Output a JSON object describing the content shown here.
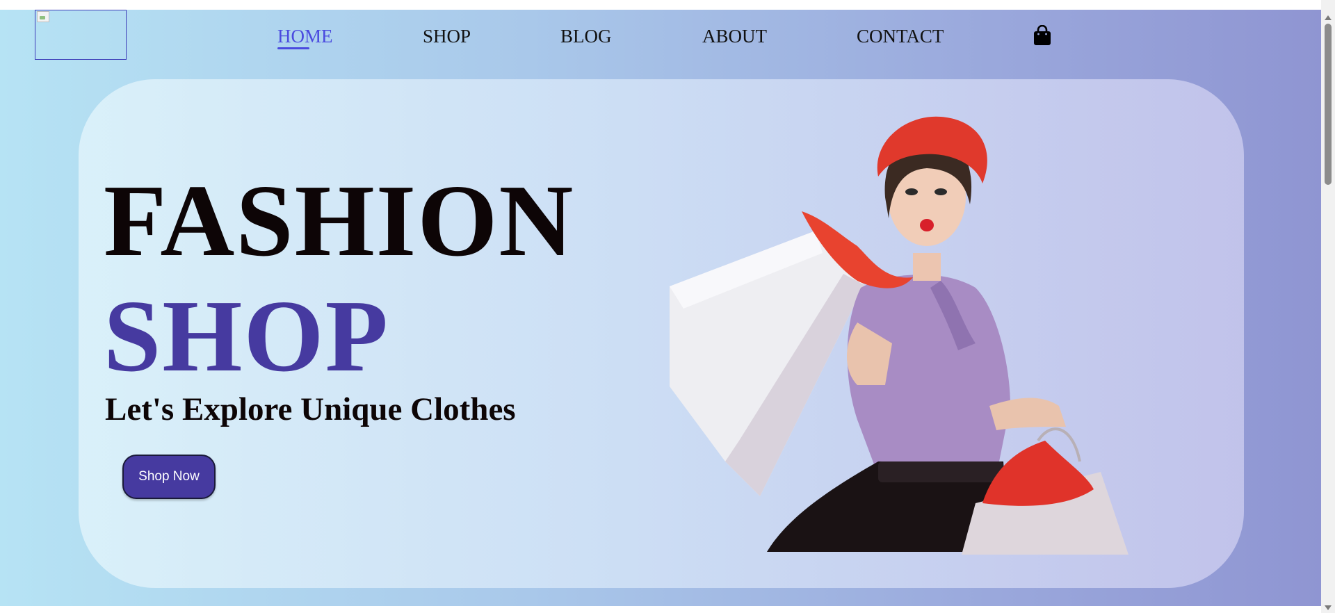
{
  "header": {
    "logo_alt": "",
    "nav": [
      {
        "label": "HOME",
        "active": true
      },
      {
        "label": "SHOP"
      },
      {
        "label": "BLOG"
      },
      {
        "label": "ABOUT"
      },
      {
        "label": "CONTACT"
      }
    ],
    "cart_icon": "shopping-bag-icon"
  },
  "hero": {
    "title_line1": "FASHION",
    "title_line2": "SHOP",
    "subtitle": "Let's Explore Unique Clothes",
    "cta_label": "Shop Now",
    "image": "woman-with-shopping-bags"
  },
  "colors": {
    "accent": "#463aa0",
    "nav_active": "#4a4adf",
    "text": "#0d0506"
  }
}
